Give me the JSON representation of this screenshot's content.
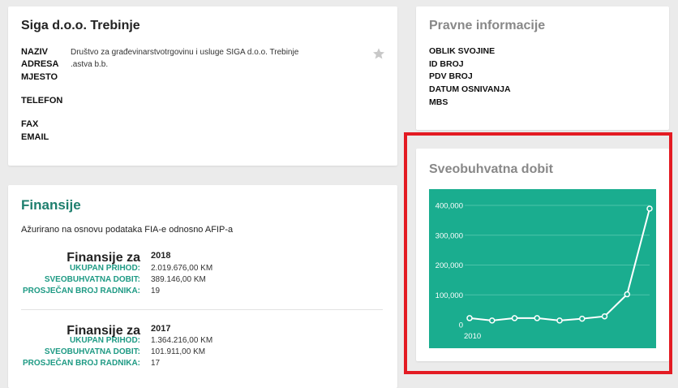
{
  "company": {
    "title": "Siga d.o.o. Trebinje",
    "fields": [
      {
        "label": "NAZIV",
        "value": "Društvo za građevinarstvotrgovinu i usluge SIGA d.o.o. Trebinje"
      },
      {
        "label": "ADRESA",
        "value": ".astva b.b."
      },
      {
        "label": "MJESTO",
        "value": ""
      },
      {
        "label": "TELEFON",
        "value": ""
      },
      {
        "label": "FAX",
        "value": ""
      },
      {
        "label": "EMAIL",
        "value": ""
      }
    ],
    "star_icon": "star-icon"
  },
  "finance": {
    "title": "Finansije",
    "subtitle": "Ažurirano na osnovu podataka FIA-e odnosno AFIP-a",
    "years": [
      {
        "year_label": "Finansije za",
        "year": "2018",
        "revenue_label": "UKUPAN PRIHOD:",
        "revenue": "2.019.676,00 KM",
        "profit_label": "SVEOBUHVATNA DOBIT:",
        "profit": "389.146,00 KM",
        "employees_label": "PROSJEČAN BROJ RADNIKA:",
        "employees": "19"
      },
      {
        "year_label": "Finansije za",
        "year": "2017",
        "revenue_label": "UKUPAN PRIHOD:",
        "revenue": "1.364.216,00 KM",
        "profit_label": "SVEOBUHVATNA DOBIT:",
        "profit": "101.911,00 KM",
        "employees_label": "PROSJEČAN BROJ RADNIKA:",
        "employees": "17"
      }
    ]
  },
  "legal": {
    "title": "Pravne informacije",
    "labels": [
      "OBLIK SVOJINE",
      "ID BROJ",
      "PDV BROJ",
      "DATUM OSNIVANJA",
      "MBS"
    ]
  },
  "profit_chart": {
    "title": "Sveobuhvatna dobit"
  },
  "chart_data": {
    "type": "line",
    "title": "",
    "xlabel": "",
    "ylabel": "",
    "x_tick_label": "2010",
    "ytick_labels": [
      "400,000",
      "300,000",
      "200,000",
      "100,000",
      "0"
    ],
    "yticks": [
      400000,
      300000,
      200000,
      100000,
      0
    ],
    "ylim": [
      0,
      400000
    ],
    "x": [
      2010,
      2011,
      2012,
      2013,
      2014,
      2015,
      2016,
      2017,
      2018
    ],
    "values": [
      22000,
      14000,
      22000,
      22000,
      14000,
      20000,
      28000,
      101911,
      389146
    ],
    "grid": true,
    "colors": {
      "background": "#1aad8f",
      "line": "#ffffff",
      "grid": "#4cc3aa"
    }
  }
}
